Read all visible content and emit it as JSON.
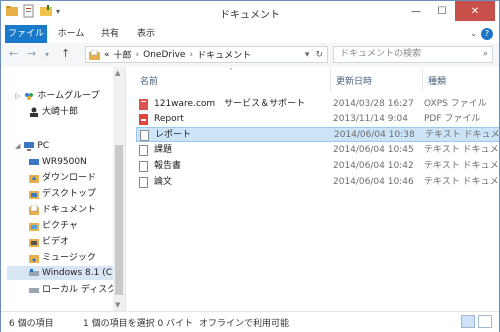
{
  "window": {
    "title": "ドキュメント",
    "minimize": "—",
    "maximize": "☐",
    "close": "✕"
  },
  "ribbon": {
    "tabs": [
      {
        "label": "ファイル"
      },
      {
        "label": "ホーム"
      },
      {
        "label": "共有"
      },
      {
        "label": "表示"
      }
    ],
    "help": "?",
    "expand": "⌄"
  },
  "nav": {
    "back": "←",
    "forward": "→",
    "up": "↑",
    "history": "▾",
    "refresh": "↻",
    "breadcrumb": [
      "«",
      "十郎",
      "OneDrive",
      "ドキュメント"
    ],
    "search_placeholder": "ドキュメントの検索"
  },
  "nav_pane": [
    {
      "label": "ホームグループ",
      "icon": "homegroup-icon"
    },
    {
      "label": "大崎十郎",
      "icon": "user-icon"
    },
    {
      "label": "PC",
      "icon": "pc-icon"
    },
    {
      "label": "WR9500N",
      "icon": "network-drive-icon"
    },
    {
      "label": "ダウンロード",
      "icon": "download-folder-icon"
    },
    {
      "label": "デスクトップ",
      "icon": "desktop-folder-icon"
    },
    {
      "label": "ドキュメント",
      "icon": "documents-folder-icon"
    },
    {
      "label": "ピクチャ",
      "icon": "pictures-folder-icon"
    },
    {
      "label": "ビデオ",
      "icon": "videos-folder-icon"
    },
    {
      "label": "ミュージック",
      "icon": "music-folder-icon"
    },
    {
      "label": "Windows 8.1 (C",
      "icon": "drive-icon"
    },
    {
      "label": "ローカル ディスク (E",
      "icon": "drive-icon"
    }
  ],
  "columns": {
    "name": "名前",
    "date": "更新日時",
    "type": "種類"
  },
  "files": [
    {
      "name": "121ware.com　サービス＆サポート",
      "date": "2014/03/28 16:27",
      "type": "OXPS ファイル",
      "icon": "oxps-icon"
    },
    {
      "name": "Report",
      "date": "2013/11/14 9:04",
      "type": "PDF ファイル",
      "icon": "pdf-icon"
    },
    {
      "name": "レポート",
      "date": "2014/06/04 10:38",
      "type": "テキスト ドキュメント",
      "icon": "text-file-icon"
    },
    {
      "name": "課題",
      "date": "2014/06/04 10:45",
      "type": "テキスト ドキュメント",
      "icon": "text-file-icon"
    },
    {
      "name": "報告書",
      "date": "2014/06/04 10:42",
      "type": "テキスト ドキュメント",
      "icon": "text-file-icon"
    },
    {
      "name": "論文",
      "date": "2014/06/04 10:46",
      "type": "テキスト ドキュメント",
      "icon": "text-file-icon"
    }
  ],
  "status": {
    "count": "6 個の項目",
    "selected": "1 個の項目を選択 0 バイト",
    "availability": "オフラインで利用可能"
  },
  "colors": {
    "accent": "#1979ca",
    "selection": "#cce4f7",
    "close": "#c7504b"
  }
}
